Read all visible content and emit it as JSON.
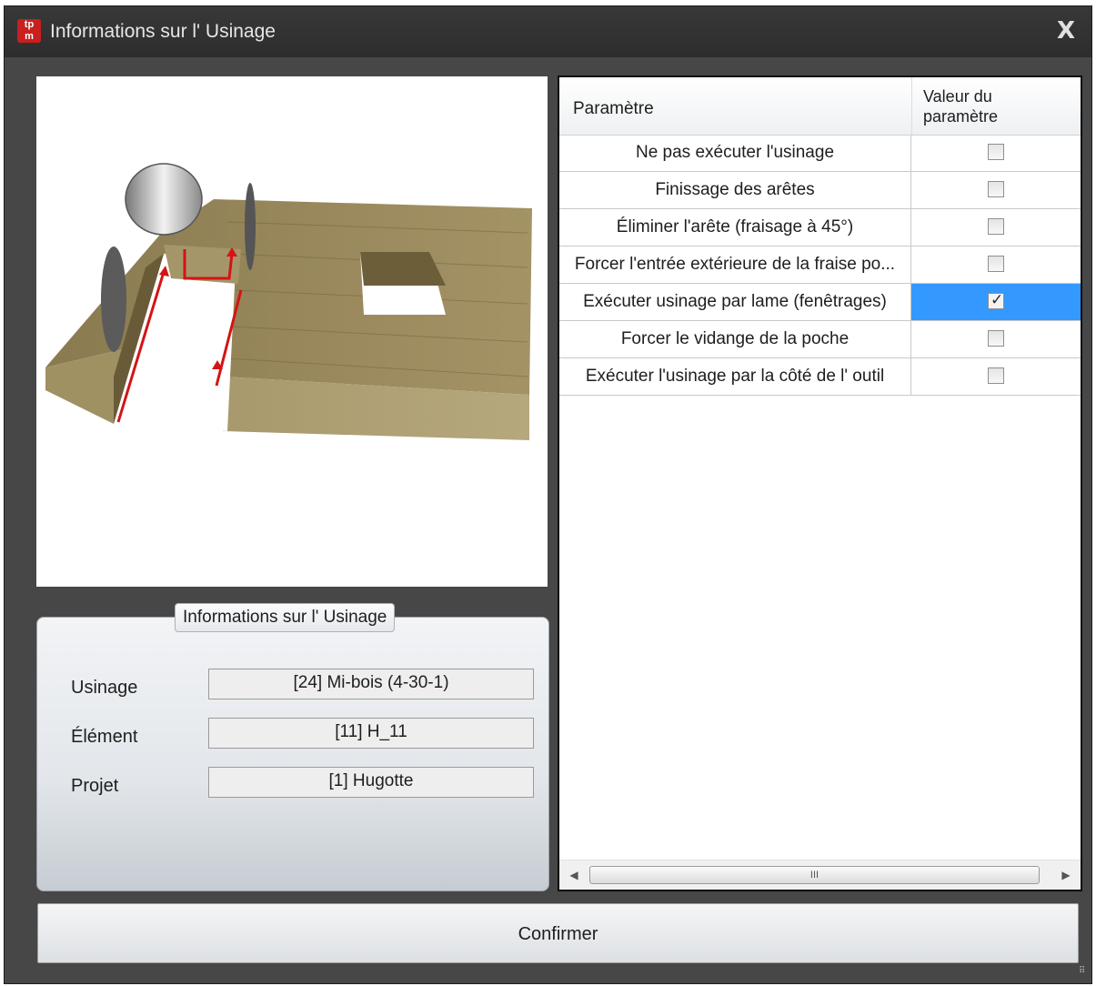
{
  "window": {
    "title": "Informations sur l' Usinage",
    "close_label": "X",
    "icon": "app-logo-icon",
    "icon_text_top": "tp",
    "icon_text_bottom": "m"
  },
  "grid": {
    "header_param": "Paramètre",
    "header_value_line1": "Valeur du",
    "header_value_line2": "paramètre",
    "rows": [
      {
        "label": "Ne pas exécuter l'usinage",
        "checked": false
      },
      {
        "label": "Finissage des arêtes",
        "checked": false
      },
      {
        "label": "Éliminer l'arête (fraisage à 45°)",
        "checked": false
      },
      {
        "label": "Forcer l'entrée extérieure de la fraise po...",
        "checked": false
      },
      {
        "label": "Exécuter usinage par lame (fenêtrages)",
        "checked": true,
        "selected": true
      },
      {
        "label": "Forcer le vidange de la poche",
        "checked": false
      },
      {
        "label": "Exécuter l'usinage par la côté de l' outil",
        "checked": false
      }
    ],
    "scroll_thumb_text": "III",
    "scroll_left": "◀",
    "scroll_right": "▶"
  },
  "info": {
    "legend": "Informations sur l' Usinage",
    "usinage_label": "Usinage",
    "usinage_value": "[24] Mi-bois (4-30-1)",
    "element_label": "Élément",
    "element_value": "[11] H_11",
    "projet_label": "Projet",
    "projet_value": "[1] Hugotte"
  },
  "confirm_label": "Confirmer",
  "colors": {
    "selected_row": "#3399ff",
    "window_bg": "#474747",
    "wood": "#8b7a52",
    "path": "#d41414"
  }
}
